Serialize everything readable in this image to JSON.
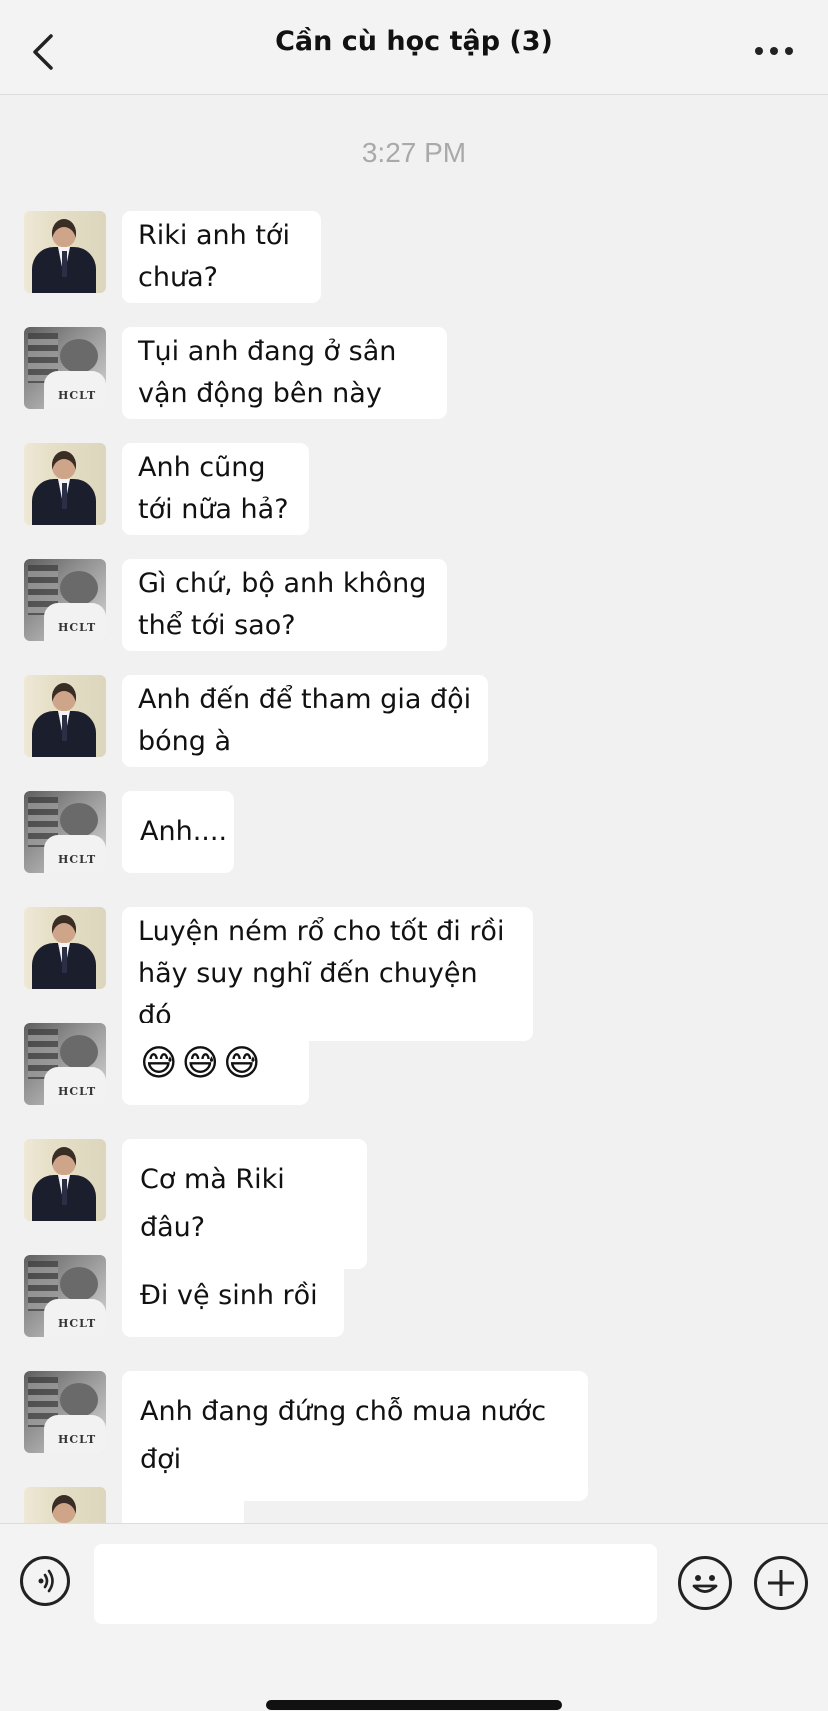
{
  "header": {
    "title": "Cần cù học tập (3)",
    "back_icon": "chevron-left-icon",
    "more_icon": "more-horizontal-icon"
  },
  "chat": {
    "timestamp": "3:27 PM",
    "messages": [
      {
        "sender": "suit-avatar",
        "lines": [
          "Riki anh tới",
          "chưa?"
        ]
      },
      {
        "sender": "bw-avatar",
        "lines": [
          "Tụi anh đang ở sân",
          "vận động bên này"
        ]
      },
      {
        "sender": "suit-avatar",
        "lines": [
          "Anh cũng",
          "tới nữa hả?"
        ]
      },
      {
        "sender": "bw-avatar",
        "lines": [
          "Gì chứ, bộ anh không",
          "thể tới sao?"
        ]
      },
      {
        "sender": "suit-avatar",
        "lines": [
          "Anh đến để tham gia đội",
          "bóng à"
        ]
      },
      {
        "sender": "bw-avatar",
        "lines": [
          "Anh...."
        ]
      },
      {
        "sender": "suit-avatar",
        "lines": [
          "Luyện ném rổ cho tốt đi rồi",
          "hãy suy nghĩ đến chuyện đó"
        ]
      },
      {
        "sender": "bw-avatar",
        "lines": [
          "😅😅😅"
        ]
      },
      {
        "sender": "suit-avatar",
        "lines": [
          "Cơ mà Riki đâu?"
        ]
      },
      {
        "sender": "bw-avatar",
        "lines": [
          "Đi vệ sinh rồi"
        ]
      },
      {
        "sender": "bw-avatar",
        "lines": [
          "Anh đang đứng chỗ mua nước đợi"
        ]
      }
    ]
  },
  "input_bar": {
    "voice_icon": "voice-icon",
    "input_value": "",
    "emoji_icon": "smiley-icon",
    "plus_icon": "plus-icon"
  },
  "colors": {
    "background": "#f1f1f1",
    "bubble": "#ffffff",
    "timestamp": "#a9a9a9"
  }
}
